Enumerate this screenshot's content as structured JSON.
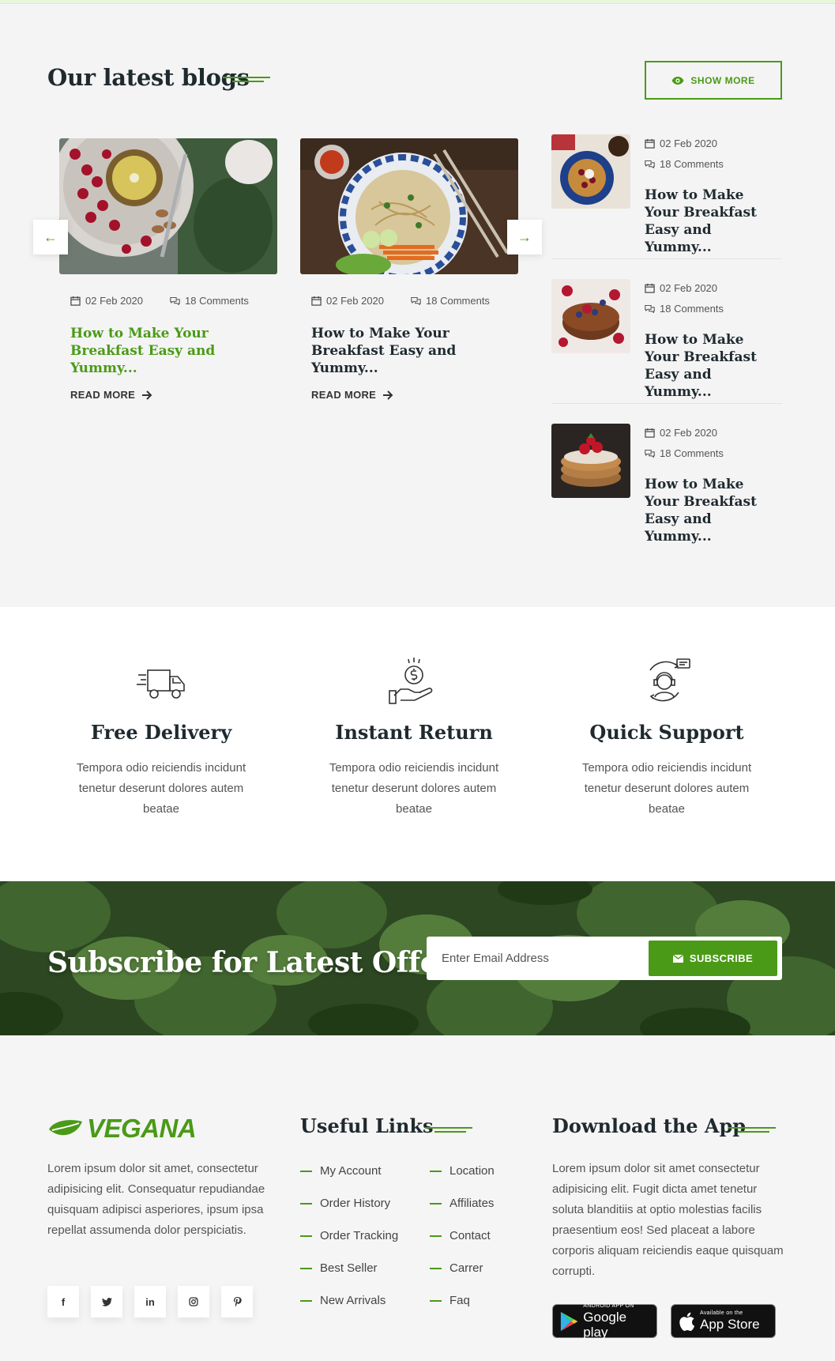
{
  "blogs": {
    "title": "Our latest blogs",
    "show_more": "SHOW MORE",
    "cards": [
      {
        "date": "02 Feb 2020",
        "comments": "18 Comments",
        "title": "How to Make Your Breakfast Easy and Yummy...",
        "read_more": "READ MORE"
      },
      {
        "date": "02 Feb 2020",
        "comments": "18 Comments",
        "title": "How to Make Your Breakfast Easy and Yummy...",
        "read_more": "READ MORE"
      }
    ],
    "side": [
      {
        "date": "02 Feb 2020",
        "comments": "18 Comments",
        "title": "How to Make Your Breakfast Easy and Yummy..."
      },
      {
        "date": "02 Feb 2020",
        "comments": "18 Comments",
        "title": "How to Make Your Breakfast Easy and Yummy..."
      },
      {
        "date": "02 Feb 2020",
        "comments": "18 Comments",
        "title": "How to Make Your Breakfast Easy and Yummy..."
      }
    ],
    "prev_arrow": "←",
    "next_arrow": "→"
  },
  "features": [
    {
      "icon": "delivery-truck-icon",
      "title": "Free Delivery",
      "text": "Tempora odio reiciendis incidunt tenetur deserunt dolores autem beatae"
    },
    {
      "icon": "money-return-icon",
      "title": "Instant Return",
      "text": "Tempora odio reiciendis incidunt tenetur deserunt dolores autem beatae"
    },
    {
      "icon": "customer-support-icon",
      "title": "Quick Support",
      "text": "Tempora odio reiciendis incidunt tenetur deserunt dolores autem beatae"
    }
  ],
  "subscribe": {
    "title": "Subscribe for Latest Offers",
    "placeholder": "Enter Email Address",
    "button": "SUBSCRIBE"
  },
  "footer": {
    "logo": "VEGANA",
    "about": "Lorem ipsum dolor sit amet, consectetur adipisicing elit. Consequatur repudiandae quisquam adipisci asperiores, ipsum ipsa repellat assumenda dolor perspiciatis.",
    "socials": [
      "f",
      "t",
      "in",
      "ig",
      "p"
    ],
    "useful_links_title": "Useful Links",
    "links_col1": [
      "My Account",
      "Order History",
      "Order Tracking",
      "Best Seller",
      "New Arrivals"
    ],
    "links_col2": [
      "Location",
      "Affiliates",
      "Contact",
      "Carrer",
      "Faq"
    ],
    "app_title": "Download the App",
    "app_text": "Lorem ipsum dolor sit amet consectetur adipisicing elit. Fugit dicta amet tenetur soluta blanditiis at optio molestias facilis praesentium eos! Sed placeat a labore corporis aliquam reiciendis eaque quisquam corrupti.",
    "google_small": "ANDROID APP ON",
    "google_big": "Google play",
    "apple_small": "Available on the",
    "apple_big": "App Store"
  },
  "colors": {
    "accent": "#4a9a17",
    "heading": "#1f2a2f",
    "background": "#f5f5f5"
  }
}
